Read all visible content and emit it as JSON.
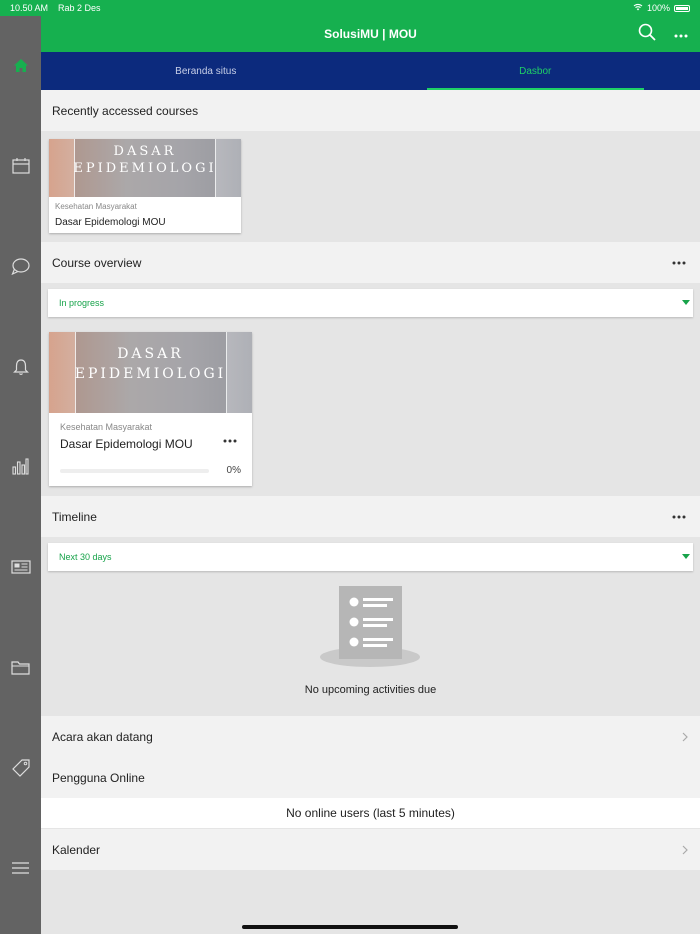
{
  "status_bar": {
    "time": "10.50 AM",
    "date": "Rab 2 Des",
    "battery": "100%"
  },
  "sidebar": {
    "items": [
      {
        "icon": "home-icon",
        "active": true
      },
      {
        "icon": "calendar-icon"
      },
      {
        "icon": "chat-icon"
      },
      {
        "icon": "bell-icon"
      },
      {
        "icon": "grades-icon"
      },
      {
        "icon": "news-icon"
      },
      {
        "icon": "folder-icon"
      },
      {
        "icon": "tag-icon"
      },
      {
        "icon": "menu-icon"
      }
    ]
  },
  "app_bar": {
    "title": "SolusiMU | MOU"
  },
  "tabs": [
    {
      "label": "Beranda situs",
      "active": false
    },
    {
      "label": "Dasbor",
      "active": true
    }
  ],
  "recent": {
    "title": "Recently accessed courses",
    "course": {
      "image_text_1": "DASAR",
      "image_text_2": "EPIDEMIOLOGI",
      "category": "Kesehatan Masyarakat",
      "name": "Dasar Epidemologi MOU"
    }
  },
  "overview": {
    "title": "Course overview",
    "filter": "In progress",
    "course": {
      "image_text_1": "DASAR",
      "image_text_2": "EPIDEMIOLOGI",
      "category": "Kesehatan Masyarakat",
      "name": "Dasar Epidemologi MOU",
      "progress_label": "0%",
      "progress": 0
    }
  },
  "timeline": {
    "title": "Timeline",
    "filter": "Next 30 days",
    "empty_text": "No upcoming activities due"
  },
  "upcoming": {
    "title": "Acara akan datang"
  },
  "online_users": {
    "title": "Pengguna Online",
    "empty_text": "No online users (last 5 minutes)"
  },
  "calendar": {
    "title": "Kalender"
  },
  "colors": {
    "brand_green": "#16b04f",
    "nav_blue": "#0c2a7d",
    "sidebar_gray": "#636363"
  }
}
